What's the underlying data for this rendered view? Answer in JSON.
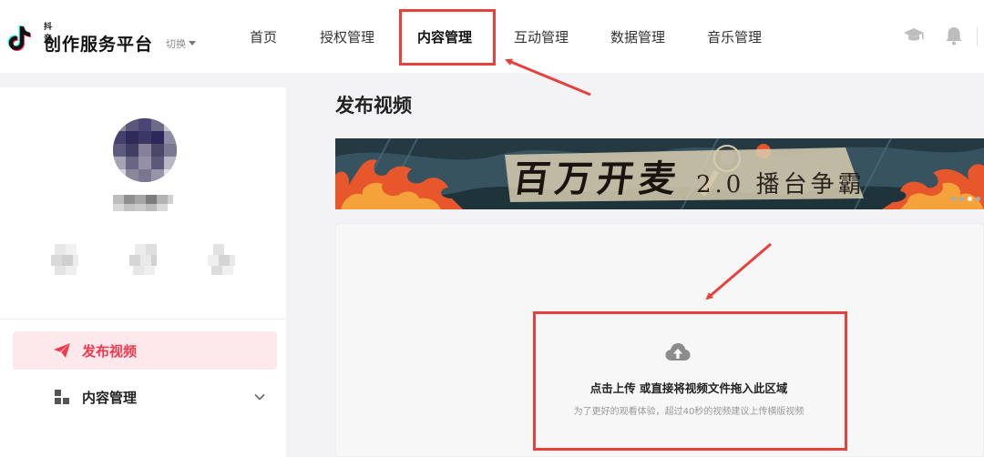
{
  "brand": {
    "small_label": "抖音",
    "name": "创作服务平台",
    "switch_label": "切换"
  },
  "nav": {
    "items": [
      {
        "label": "首页"
      },
      {
        "label": "授权管理"
      },
      {
        "label": "内容管理",
        "active": true
      },
      {
        "label": "互动管理"
      },
      {
        "label": "数据管理"
      },
      {
        "label": "音乐管理"
      }
    ]
  },
  "top_icons": [
    "graduation-cap-icon",
    "bell-icon"
  ],
  "sidebar": {
    "menu": [
      {
        "label": "发布视频",
        "icon": "paper-plane-icon",
        "active": true
      },
      {
        "label": "内容管理",
        "icon": "grid-icon",
        "expandable": true
      }
    ]
  },
  "main": {
    "title": "发布视频",
    "banner": {
      "headline": "百万开麦",
      "tagline": "2.0 播台争霸"
    },
    "upload": {
      "main_text": "点击上传 或直接将视频文件拖入此区域",
      "hint_text": "为了更好的观看体验，超过40秒的视频建议上传横版视频",
      "icon": "cloud-upload-icon"
    }
  },
  "colors": {
    "accent": "#f0394f",
    "annotation": "#e8413d",
    "active_menu_bg": "#fde9eb",
    "page_bg": "#f3f3f5"
  }
}
